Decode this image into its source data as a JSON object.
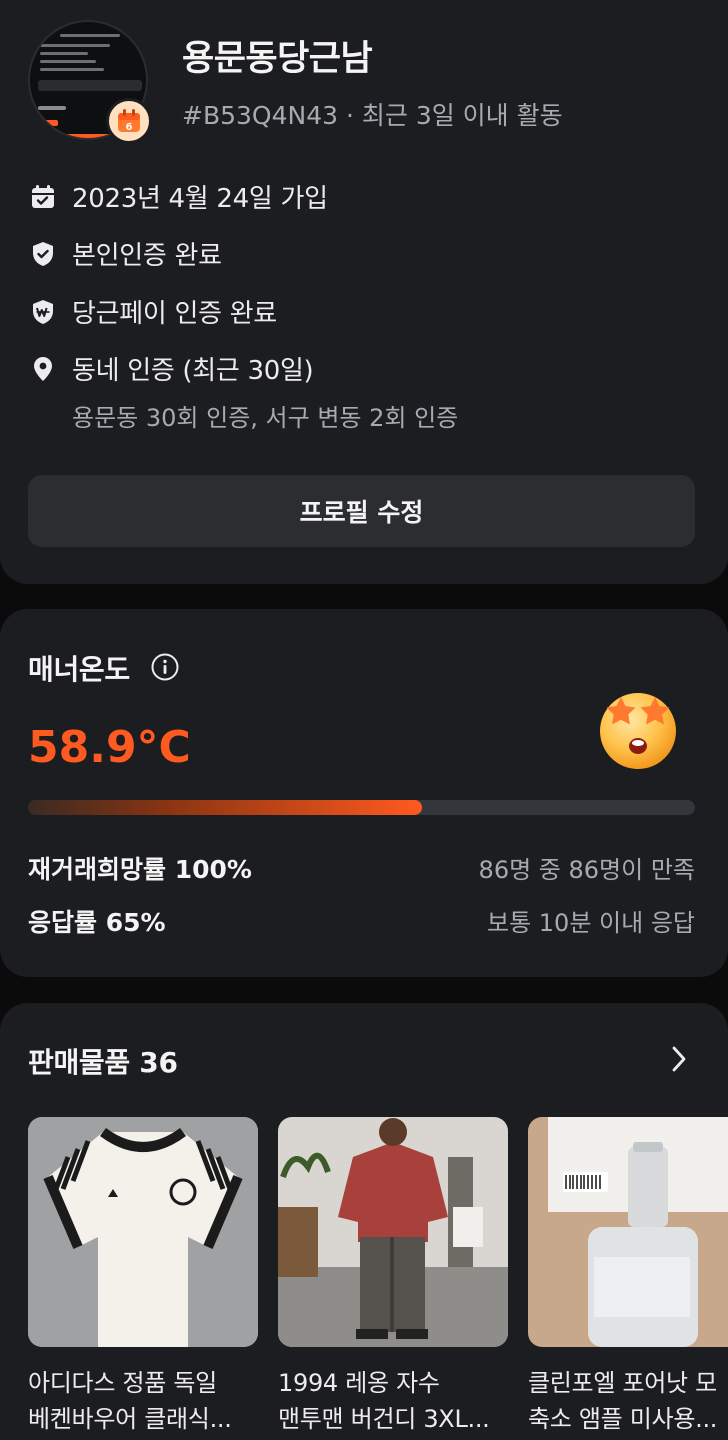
{
  "profile": {
    "nickname": "용문동당근남",
    "user_id": "#B53Q4N43",
    "activity": "최근 3일 이내 활동",
    "joined": "2023년 4월 24일 가입",
    "identity": "본인인증 완료",
    "pay": "당근페이 인증 완료",
    "neighborhood": "동네 인증 (최근 30일)",
    "neighborhood_detail": "용문동 30회 인증, 서구 변동 2회 인증",
    "edit_button": "프로필 수정",
    "icons": [
      "calendar-check-icon",
      "shield-check-icon",
      "shield-won-icon",
      "location-pin-icon"
    ]
  },
  "manner": {
    "title": "매너온도",
    "temperature": "58.9°C",
    "temperature_value": 58.9,
    "bar_fraction": 0.59,
    "rehire_label": "재거래희망률 100%",
    "rehire_detail": "86명 중 86명이 만족",
    "response_label": "응답률 65%",
    "response_detail": "보통 10분 이내 응답",
    "accent_color": "#ff5a1f"
  },
  "sales": {
    "title": "판매물품 36",
    "items": [
      {
        "line1": "아디다스 정품 독일",
        "line2": "베켄바우어 클래식..."
      },
      {
        "line1": "1994 레옹 자수",
        "line2": "맨투맨 버건디 3XL..."
      },
      {
        "line1": "클린포엘 포어낫 모",
        "line2": "축소 앰플 미사용..."
      }
    ]
  }
}
